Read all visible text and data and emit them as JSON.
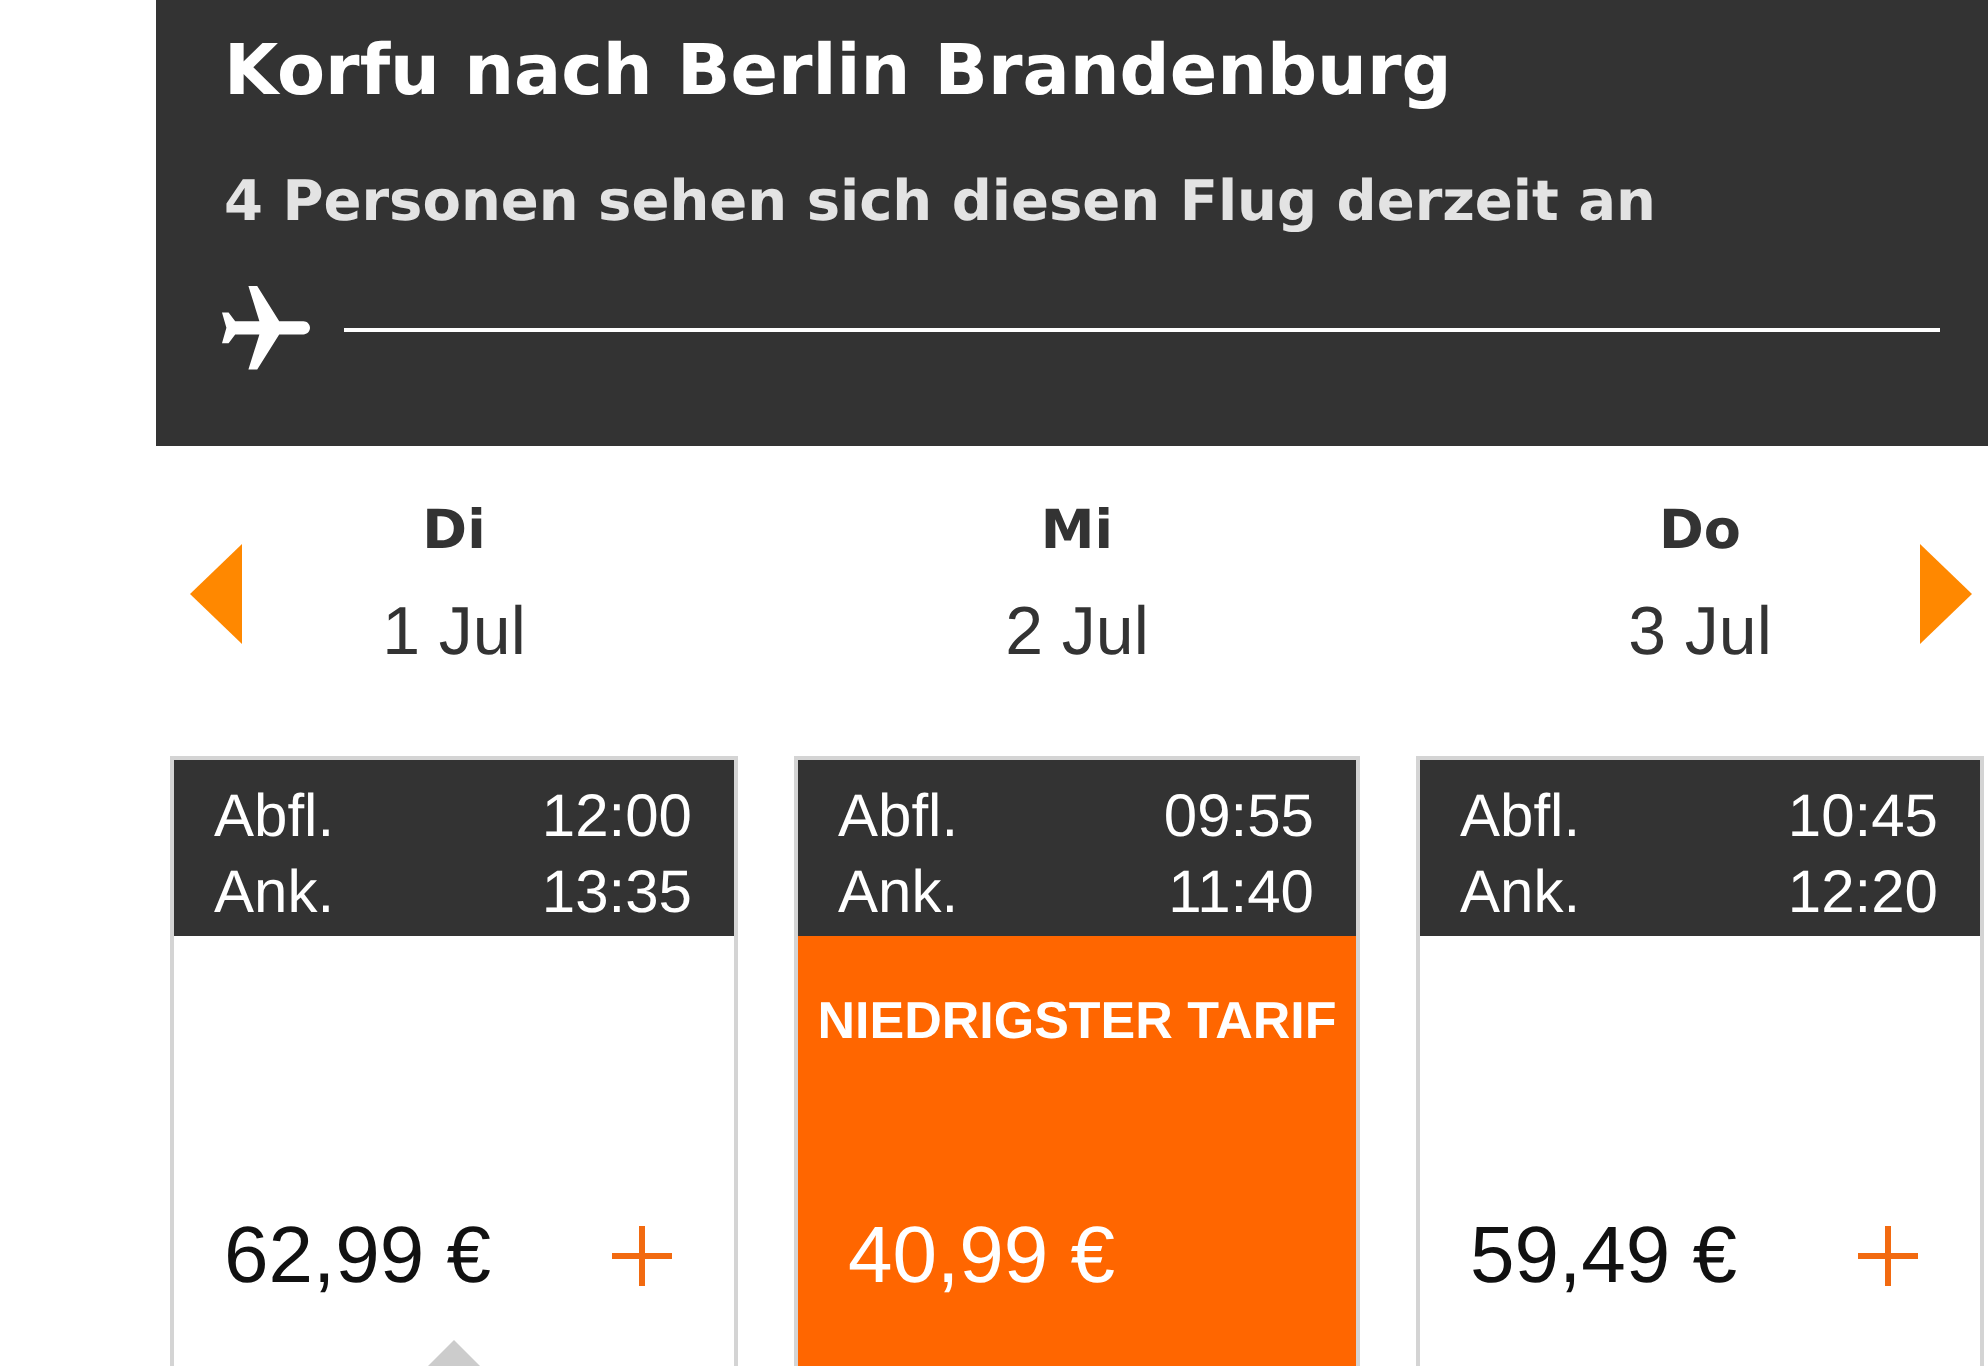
{
  "header": {
    "title": "Korfu nach Berlin Brandenburg",
    "subtitle": "4 Personen sehen sich diesen Flug derzeit an"
  },
  "date_nav": {
    "days": [
      {
        "weekday": "Di",
        "date": "1 Jul"
      },
      {
        "weekday": "Mi",
        "date": "2 Jul"
      },
      {
        "weekday": "Do",
        "date": "3 Jul"
      }
    ]
  },
  "flights": [
    {
      "departure_label": "Abfl.",
      "departure_time": "12:00",
      "arrival_label": "Ank.",
      "arrival_time": "13:35",
      "price": "62,99 €",
      "selected": false,
      "pointer": true
    },
    {
      "departure_label": "Abfl.",
      "departure_time": "09:55",
      "arrival_label": "Ank.",
      "arrival_time": "11:40",
      "badge": "NIEDRIGSTER TARIF",
      "price": "40,99 €",
      "selected": true,
      "pointer": false
    },
    {
      "departure_label": "Abfl.",
      "departure_time": "10:45",
      "arrival_label": "Ank.",
      "arrival_time": "12:20",
      "price": "59,49 €",
      "selected": false,
      "pointer": false
    }
  ]
}
